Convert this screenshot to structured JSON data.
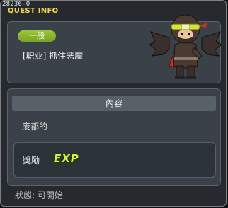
{
  "window": {
    "id_code": "28236-0",
    "title": "QUEST INFO"
  },
  "quest": {
    "category": "一般",
    "name": "[职业] 抓住恶魔",
    "npc_icon": "masked-ninja-npc-icon"
  },
  "content": {
    "header": "內容",
    "description": "废都的"
  },
  "reward": {
    "label": "獎勵",
    "exp_text": "EXP",
    "exp_icon": "exp-icon"
  },
  "status": {
    "text": "狀態: 可開始"
  },
  "colors": {
    "title": "#f2d64c",
    "category_pill": "#8ab530",
    "exp": "#d8ee3c"
  }
}
